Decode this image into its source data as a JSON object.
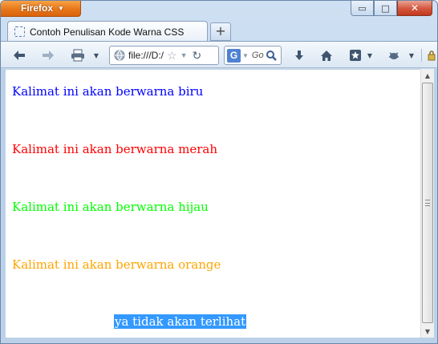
{
  "app": {
    "menu_button_label": "Firefox"
  },
  "tabs": [
    {
      "label": "Contoh Penulisan Kode Warna CSS",
      "active": true
    }
  ],
  "new_tab_label": "+",
  "toolbar": {
    "url": "file:///D:/",
    "search_placeholder": "Go",
    "search_engine_icon": "G"
  },
  "window_controls": {
    "minimize": "▭",
    "maximize": "□",
    "close": "✕"
  },
  "content": {
    "lines": [
      {
        "text": "Kalimat ini akan berwarna biru",
        "color": "#0000ff"
      },
      {
        "text": "Kalimat ini akan berwarna merah",
        "color": "#ff0000"
      },
      {
        "text": "Kalimat ini akan berwarna hijau",
        "color": "#00ff00"
      },
      {
        "text": "Kalimat ini akan berwarna orange",
        "color": "#ffa500"
      },
      {
        "text": "ya tidak akan terlihat",
        "color": "#ffffff",
        "selection_color": "#3399ff"
      }
    ]
  },
  "scrollbar": {
    "up_arrow": "▲",
    "down_arrow": "▼"
  }
}
